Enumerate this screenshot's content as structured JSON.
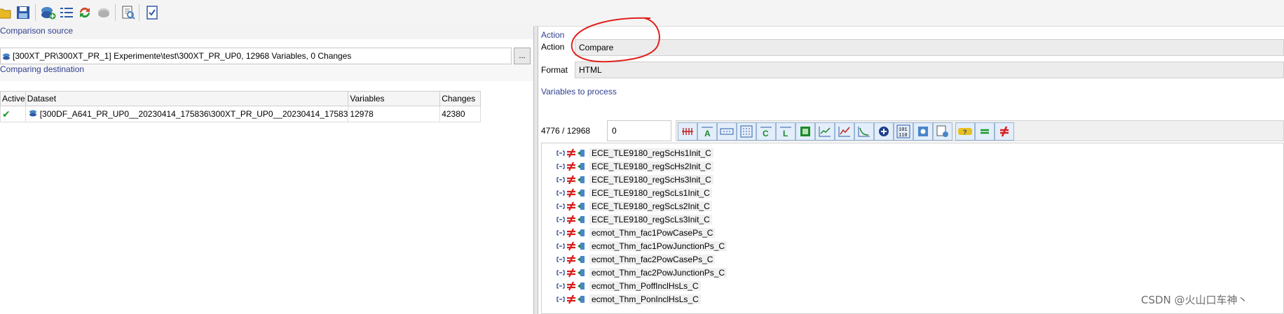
{
  "toolbar": {
    "buttons": [
      {
        "icon": "folder-open-icon",
        "color": "#e8b923"
      },
      {
        "icon": "save-icon",
        "color": "#2e5aa8"
      },
      {
        "icon": "add-dataset-icon",
        "color": "#4a86c8"
      },
      {
        "icon": "list-icon",
        "color": "#2e5aa8"
      },
      {
        "icon": "refresh-icon",
        "color": "#d04a2a"
      },
      {
        "icon": "disabled-icon",
        "color": "#b5b5b5"
      },
      {
        "icon": "preview-icon",
        "color": "#4a86c8"
      },
      {
        "icon": "checklist-icon",
        "color": "#2e5aa8"
      }
    ]
  },
  "left": {
    "source_title": "Comparison source",
    "source_value": "[300XT_PR\\300XT_PR_1] Experimente\\test\\300XT_PR_UP0, 12968 Variables, 0 Changes",
    "source_button": "...",
    "destination_title": "Comparing destination",
    "table": {
      "headers": [
        "Active",
        "Dataset",
        "Variables",
        "Changes"
      ],
      "rows": [
        {
          "active": "✔",
          "dataset": "[300DF_A641_PR_UP0__20230414_175836\\300XT_PR_UP0__20230414_17583",
          "variables": "12978",
          "changes": "42380"
        }
      ]
    }
  },
  "right": {
    "action_section": "Action",
    "action_label": "Action",
    "action_value": "Compare",
    "format_label": "Format",
    "format_value": "HTML",
    "variables_section": "Variables to process",
    "count": "4776 / 12968",
    "filter": "0",
    "var_toolbar_icons": [
      "filter-icon",
      "text-var-icon",
      "array-icon",
      "matrix-icon",
      "curve-c-icon",
      "curve-l-icon",
      "map-icon",
      "line-chart-icon",
      "line-chart2-icon",
      "surface-chart-icon",
      "add-icon",
      "binary-icon",
      "settings-icon",
      "config-icon",
      "help-icon",
      "equal-icon",
      "not-equal-icon"
    ],
    "variables": [
      "ECE_TLE9180_regScHs1Init_C",
      "ECE_TLE9180_regScHs2Init_C",
      "ECE_TLE9180_regScHs3Init_C",
      "ECE_TLE9180_regScLs1Init_C",
      "ECE_TLE9180_regScLs2Init_C",
      "ECE_TLE9180_regScLs3Init_C",
      "ecmot_Thm_fac1PowCasePs_C",
      "ecmot_Thm_fac1PowJunctionPs_C",
      "ecmot_Thm_fac2PowCasePs_C",
      "ecmot_Thm_fac2PowJunctionPs_C",
      "ecmot_Thm_PoffInclHsLs_C",
      "ecmot_Thm_PonInclHsLs_C"
    ]
  },
  "watermark": "CSDN @火山口车神丶",
  "colors": {
    "section_title": "#2f3f8f",
    "annotation": "#e0201b",
    "not_equal": "#d81e1e"
  }
}
